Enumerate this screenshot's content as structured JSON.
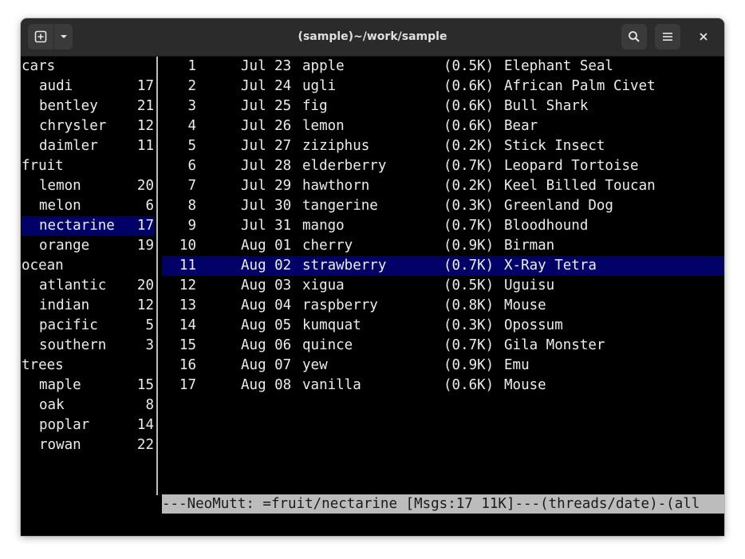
{
  "window": {
    "title": "(sample)~/work/sample"
  },
  "icons": {
    "new_tab": "new-tab-icon",
    "dropdown": "chevron-down-icon",
    "search": "search-icon",
    "menu": "hamburger-menu-icon",
    "close": "close-icon"
  },
  "colors": {
    "selection": "#000066",
    "status_bar": "#bcbcbc",
    "background": "#000000",
    "foreground": "#ececec"
  },
  "sidebar": {
    "items": [
      {
        "name": "cars",
        "count": "",
        "child": false
      },
      {
        "name": "audi",
        "count": "17",
        "child": true
      },
      {
        "name": "bentley",
        "count": "21",
        "child": true
      },
      {
        "name": "chrysler",
        "count": "12",
        "child": true
      },
      {
        "name": "daimler",
        "count": "11",
        "child": true
      },
      {
        "name": "fruit",
        "count": "",
        "child": false
      },
      {
        "name": "lemon",
        "count": "20",
        "child": true
      },
      {
        "name": "melon",
        "count": "6",
        "child": true
      },
      {
        "name": "nectarine",
        "count": "17",
        "child": true,
        "selected": true
      },
      {
        "name": "orange",
        "count": "19",
        "child": true
      },
      {
        "name": "ocean",
        "count": "",
        "child": false
      },
      {
        "name": "atlantic",
        "count": "20",
        "child": true
      },
      {
        "name": "indian",
        "count": "12",
        "child": true
      },
      {
        "name": "pacific",
        "count": "5",
        "child": true
      },
      {
        "name": "southern",
        "count": "3",
        "child": true
      },
      {
        "name": "trees",
        "count": "",
        "child": false
      },
      {
        "name": "maple",
        "count": "15",
        "child": true
      },
      {
        "name": "oak",
        "count": "8",
        "child": true
      },
      {
        "name": "poplar",
        "count": "14",
        "child": true
      },
      {
        "name": "rowan",
        "count": "22",
        "child": true
      }
    ]
  },
  "messages": [
    {
      "num": "1",
      "date": "Jul 23",
      "subject": "apple",
      "size": "(0.5K)",
      "from": "Elephant Seal"
    },
    {
      "num": "2",
      "date": "Jul 24",
      "subject": "ugli",
      "size": "(0.6K)",
      "from": "African Palm Civet"
    },
    {
      "num": "3",
      "date": "Jul 25",
      "subject": "fig",
      "size": "(0.6K)",
      "from": "Bull Shark"
    },
    {
      "num": "4",
      "date": "Jul 26",
      "subject": "lemon",
      "size": "(0.6K)",
      "from": "Bear"
    },
    {
      "num": "5",
      "date": "Jul 27",
      "subject": "ziziphus",
      "size": "(0.2K)",
      "from": "Stick Insect"
    },
    {
      "num": "6",
      "date": "Jul 28",
      "subject": "elderberry",
      "size": "(0.7K)",
      "from": "Leopard Tortoise"
    },
    {
      "num": "7",
      "date": "Jul 29",
      "subject": "hawthorn",
      "size": "(0.2K)",
      "from": "Keel Billed Toucan"
    },
    {
      "num": "8",
      "date": "Jul 30",
      "subject": "tangerine",
      "size": "(0.3K)",
      "from": "Greenland Dog"
    },
    {
      "num": "9",
      "date": "Jul 31",
      "subject": "mango",
      "size": "(0.7K)",
      "from": "Bloodhound"
    },
    {
      "num": "10",
      "date": "Aug 01",
      "subject": "cherry",
      "size": "(0.9K)",
      "from": "Birman"
    },
    {
      "num": "11",
      "date": "Aug 02",
      "subject": "strawberry",
      "size": "(0.7K)",
      "from": "X-Ray Tetra",
      "selected": true
    },
    {
      "num": "12",
      "date": "Aug 03",
      "subject": "xigua",
      "size": "(0.5K)",
      "from": "Uguisu"
    },
    {
      "num": "13",
      "date": "Aug 04",
      "subject": "raspberry",
      "size": "(0.8K)",
      "from": "Mouse"
    },
    {
      "num": "14",
      "date": "Aug 05",
      "subject": "kumquat",
      "size": "(0.3K)",
      "from": "Opossum"
    },
    {
      "num": "15",
      "date": "Aug 06",
      "subject": "quince",
      "size": "(0.7K)",
      "from": "Gila Monster"
    },
    {
      "num": "16",
      "date": "Aug 07",
      "subject": "yew",
      "size": "(0.9K)",
      "from": "Emu"
    },
    {
      "num": "17",
      "date": "Aug 08",
      "subject": "vanilla",
      "size": "(0.6K)",
      "from": "Mouse"
    }
  ],
  "status_bar": {
    "text": "---NeoMutt: =fruit/nectarine [Msgs:17 11K]---(threads/date)-(all"
  }
}
